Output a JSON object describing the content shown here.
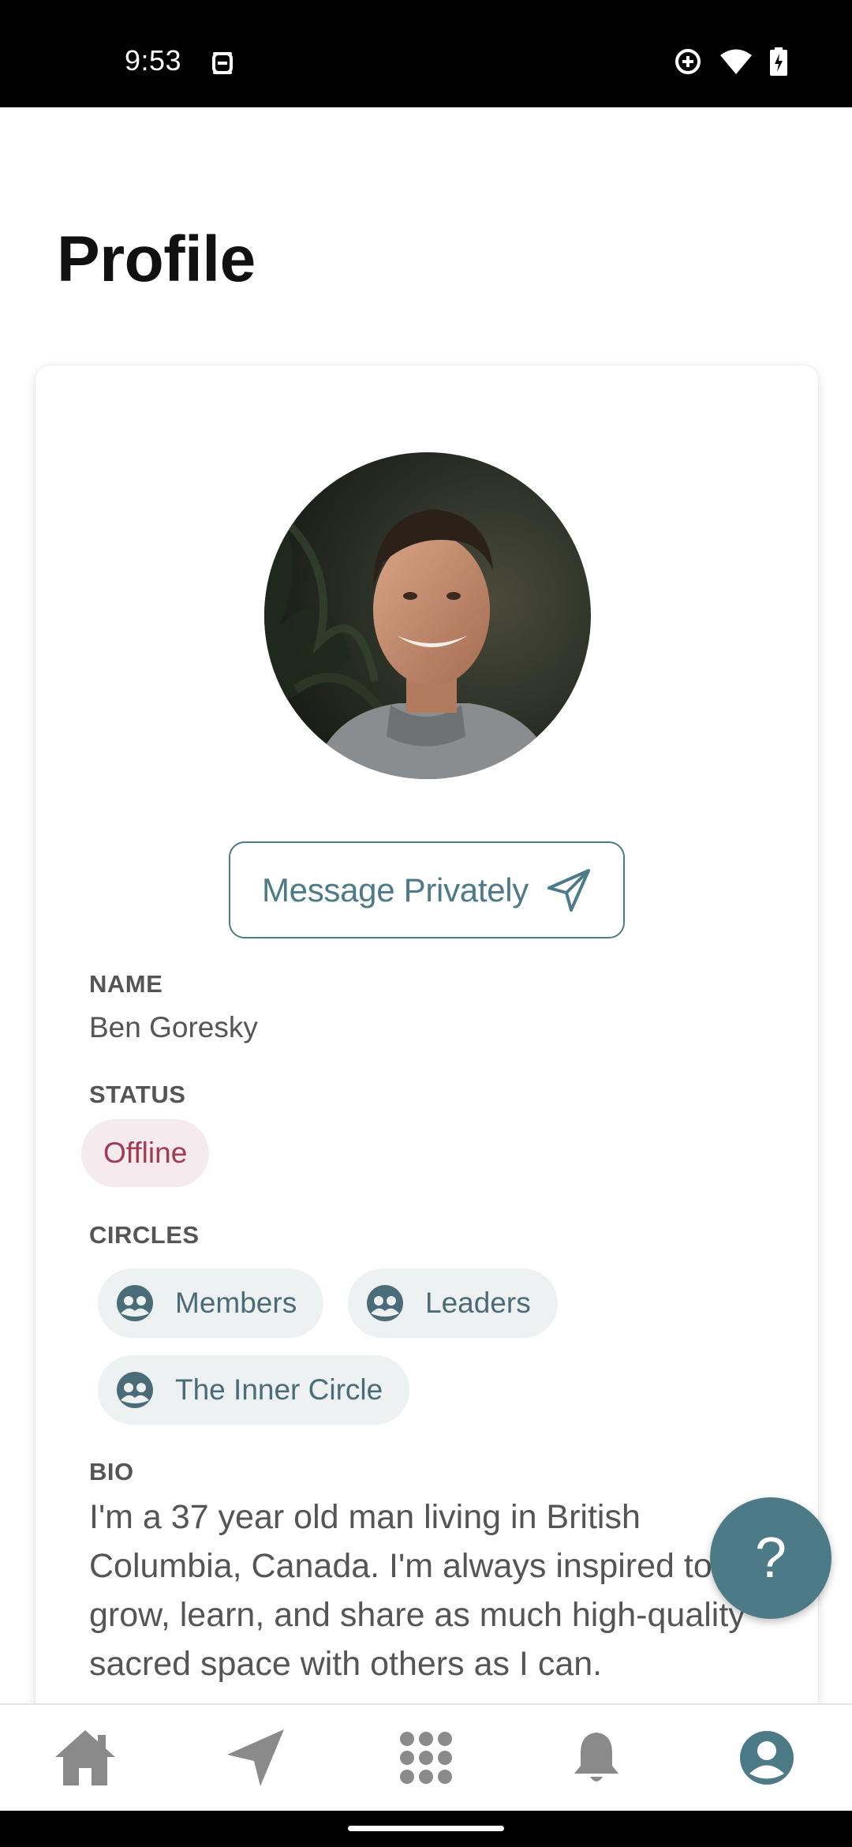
{
  "status_bar": {
    "time": "9:53",
    "icons": [
      "app-notification-icon",
      "data-saver-icon",
      "wifi-icon",
      "battery-charging-icon"
    ]
  },
  "page": {
    "title": "Profile"
  },
  "profile": {
    "avatar_alt": "profile-photo",
    "message_button_label": "Message Privately",
    "name_label": "NAME",
    "name_value": "Ben Goresky",
    "status_label": "STATUS",
    "status_value": "Offline",
    "circles_label": "CIRCLES",
    "circles": [
      {
        "label": "Members",
        "icon": "group-icon"
      },
      {
        "label": "Leaders",
        "icon": "group-icon"
      },
      {
        "label": "The Inner Circle",
        "icon": "group-icon"
      }
    ],
    "bio_label": "BIO",
    "bio_text": "I'm a 37 year old man living in British Columbia, Canada. I'm always inspired to grow, learn, and share as much high-quality sacred space with others as I can."
  },
  "fab": {
    "label": "?"
  },
  "bottom_nav": {
    "items": [
      {
        "name": "home",
        "icon": "home-icon"
      },
      {
        "name": "messages",
        "icon": "send-icon"
      },
      {
        "name": "apps",
        "icon": "grid-icon"
      },
      {
        "name": "notifications",
        "icon": "bell-icon"
      },
      {
        "name": "profile",
        "icon": "account-icon",
        "active": true
      }
    ]
  },
  "colors": {
    "accent": "#4d7a87",
    "status_offline_bg": "#f5eaee",
    "status_offline_text": "#a33a55",
    "chip_bg": "#edf1f2",
    "nav_inactive": "#8a8a8a"
  }
}
